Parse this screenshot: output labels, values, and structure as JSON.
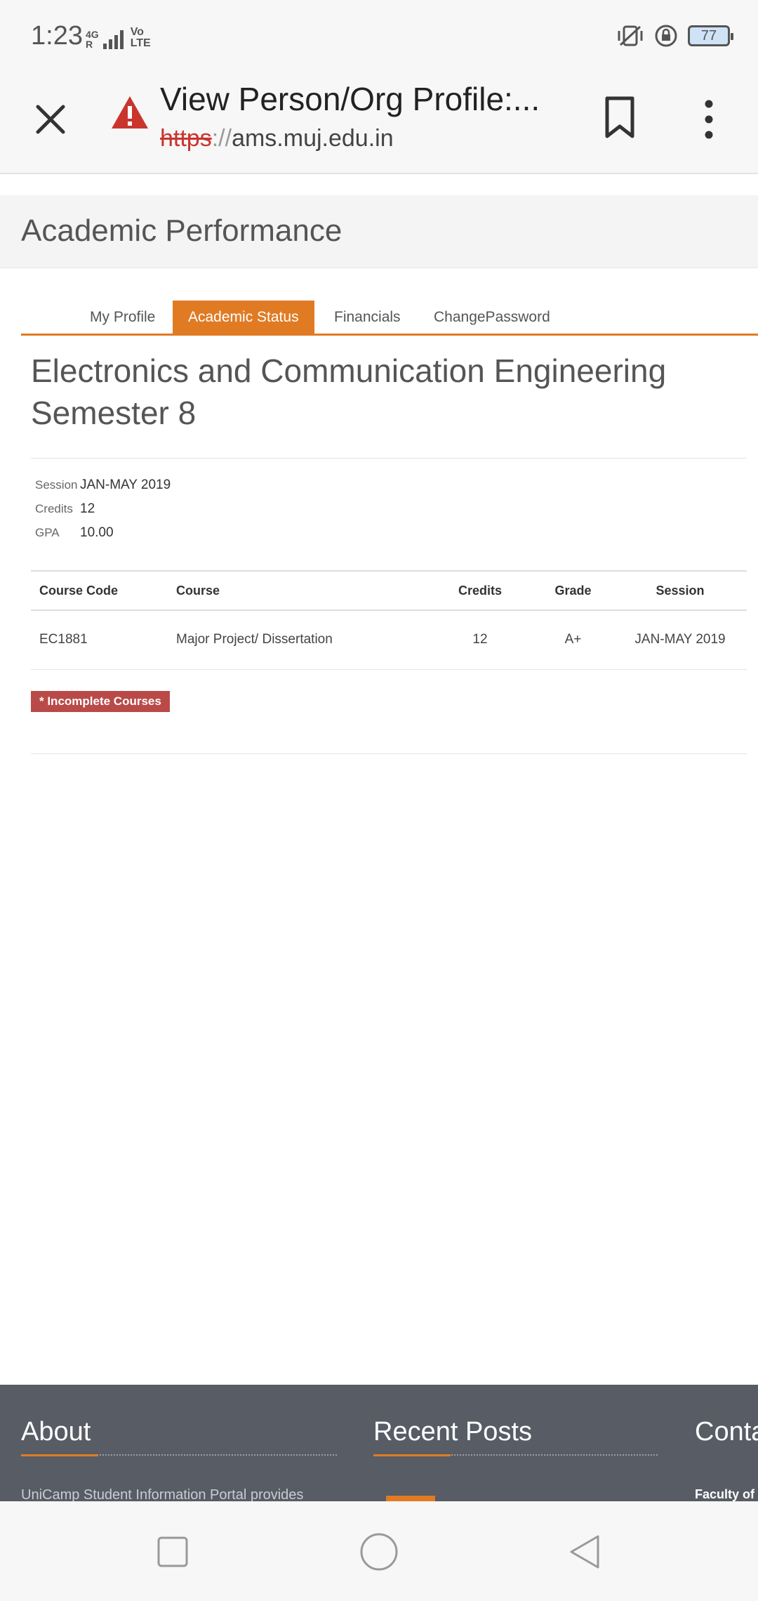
{
  "status_bar": {
    "time": "1:23",
    "net_top": "4G",
    "net_roaming": "R",
    "volte_top": "Vo",
    "volte_bottom": "LTE",
    "battery": "77"
  },
  "browser": {
    "page_title": "View Person/Org Profile:...",
    "url_scheme": "https",
    "url_sep": "://",
    "url_host": "ams.muj.edu.in"
  },
  "page": {
    "header": "Academic Performance",
    "tabs": [
      {
        "label": "My Profile"
      },
      {
        "label": "Academic Status"
      },
      {
        "label": "Financials"
      },
      {
        "label": "ChangePassword"
      }
    ],
    "program_title": "Electronics and Communication Engineering Semester 8",
    "summary": {
      "session_label": "Session",
      "session_value": "JAN-MAY 2019",
      "credits_label": "Credits",
      "credits_value": "12",
      "gpa_label": "GPA",
      "gpa_value": "10.00"
    },
    "table": {
      "headers": [
        "Course Code",
        "Course",
        "Credits",
        "Grade",
        "Session"
      ],
      "rows": [
        {
          "code": "EC1881",
          "course": "Major Project/ Dissertation",
          "credits": "12",
          "grade": "A+",
          "session": "JAN-MAY 2019"
        }
      ]
    },
    "incomplete_badge": "* Incomplete Courses"
  },
  "footer": {
    "about_title": "About",
    "about_text": "UniCamp Student Information Portal provides",
    "recent_title": "Recent Posts",
    "contact_title": "Conta",
    "contact_text": "Faculty of"
  },
  "colors": {
    "accent": "#e07b24",
    "badge": "#b94a48",
    "footer_bg": "#585c65"
  }
}
